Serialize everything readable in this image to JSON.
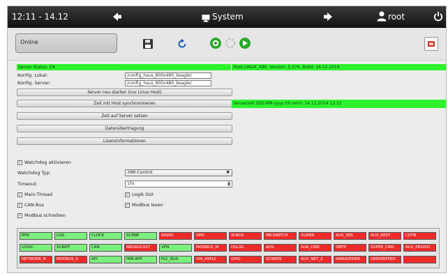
{
  "header": {
    "time": "12:11 - 14.12",
    "title": "System",
    "user": "root",
    "back_icon": "arrow-left-icon",
    "forward_icon": "arrow-right-icon",
    "monitor_icon": "monitor-icon",
    "user_icon": "user-icon",
    "power_icon": "power-icon"
  },
  "toolbar": {
    "status": "Online",
    "save_icon": "floppy-disk-icon",
    "refresh_icon": "refresh-icon",
    "zoom_in_icon": "plus-circle-icon",
    "spinner_icon": "spinner-icon",
    "zoom_out_icon": "arrow-circle-icon",
    "exit_icon": "exit-icon"
  },
  "server": {
    "status": "Server Status: OK",
    "version": "Host:LINUX_X86, Version: 5.276, Build: 14.12.2014",
    "config_local_label": "Konfig. Lokal:",
    "config_local_value": "/config_haus_800x480_beagle/",
    "config_server_label": "Konfig. Server:",
    "config_server_value": "/config_haus_800x480_beagle/",
    "server_time": "Serverzeit (DD-MM-yyyy hh:mm): 14.12.2014 12:11"
  },
  "buttons": [
    "Server neu starten (nur Linux Host)",
    "Zeit mit Host synchronisieren",
    "Zeit auf Server setzen",
    "Datenübertragung",
    "Lizenzinformationen"
  ],
  "watchdog": {
    "enable_label": "Watchdog aktivieren",
    "enable_checked": true,
    "type_label": "Watchdog Typ:",
    "type_value": "HMI-Control",
    "timeout_label": "Timeout:",
    "timeout_value": "10s",
    "checks": [
      {
        "label": "Main-Thread",
        "checked": true
      },
      {
        "label": "Logik GUI",
        "checked": true
      },
      {
        "label": "CAN Bus",
        "checked": true
      },
      {
        "label": "Modbus lesen",
        "checked": true
      },
      {
        "label": "Modbus schreiben",
        "checked": true
      }
    ]
  },
  "modules": [
    [
      {
        "label": "RFB",
        "status": "ok"
      },
      {
        "label": "LOG",
        "status": "ok"
      },
      {
        "label": "CLOCK",
        "status": "ok"
      },
      {
        "label": "SCENE",
        "status": "ok"
      },
      {
        "label": "RADIO",
        "status": "error"
      },
      {
        "label": "SMS",
        "status": "error"
      },
      {
        "label": "IR-BUS",
        "status": "error"
      },
      {
        "label": "MK-SWITCH",
        "status": "error"
      },
      {
        "label": "SLIDER",
        "status": "error"
      },
      {
        "label": "AUX_SER",
        "status": "error"
      },
      {
        "label": "AUX_REST",
        "status": "error"
      },
      {
        "label": "CDTB",
        "status": "error"
      }
    ],
    [
      {
        "label": "LOGIC",
        "status": "ok"
      },
      {
        "label": "SCRIPT",
        "status": "ok"
      },
      {
        "label": "CAN",
        "status": "ok"
      },
      {
        "label": "BROADCAST",
        "status": "error"
      },
      {
        "label": "VPN",
        "status": "ok"
      },
      {
        "label": "MODBUS_M",
        "status": "error"
      },
      {
        "label": "HSL3G",
        "status": "error"
      },
      {
        "label": "ADS",
        "status": "error"
      },
      {
        "label": "SUB_CMD",
        "status": "error"
      },
      {
        "label": "SMTP",
        "status": "error"
      },
      {
        "label": "SUPER_CMD",
        "status": "error"
      },
      {
        "label": "AUX_PROXID",
        "status": "error"
      }
    ],
    [
      {
        "label": "NETWORK_B",
        "status": "error"
      },
      {
        "label": "MODBUS_S",
        "status": "error"
      },
      {
        "label": "API",
        "status": "ok"
      },
      {
        "label": "HMI-APP",
        "status": "ok"
      },
      {
        "label": "PLC_BUS",
        "status": "ok"
      },
      {
        "label": "VIA_ASPLC",
        "status": "error"
      },
      {
        "label": "GPIO",
        "status": "error"
      },
      {
        "label": "SCREEN",
        "status": "error"
      },
      {
        "label": "AUX_NET_2",
        "status": "error"
      },
      {
        "label": "NAMAZEDER",
        "status": "error"
      },
      {
        "label": "SERVERFEED",
        "status": "error"
      },
      {
        "label": "",
        "status": "error"
      }
    ]
  ],
  "colors": {
    "ok": "#7cf07c",
    "error": "#ee2a2a",
    "status_bar": "#2ef22e",
    "topbar": "#1a1a1a"
  }
}
